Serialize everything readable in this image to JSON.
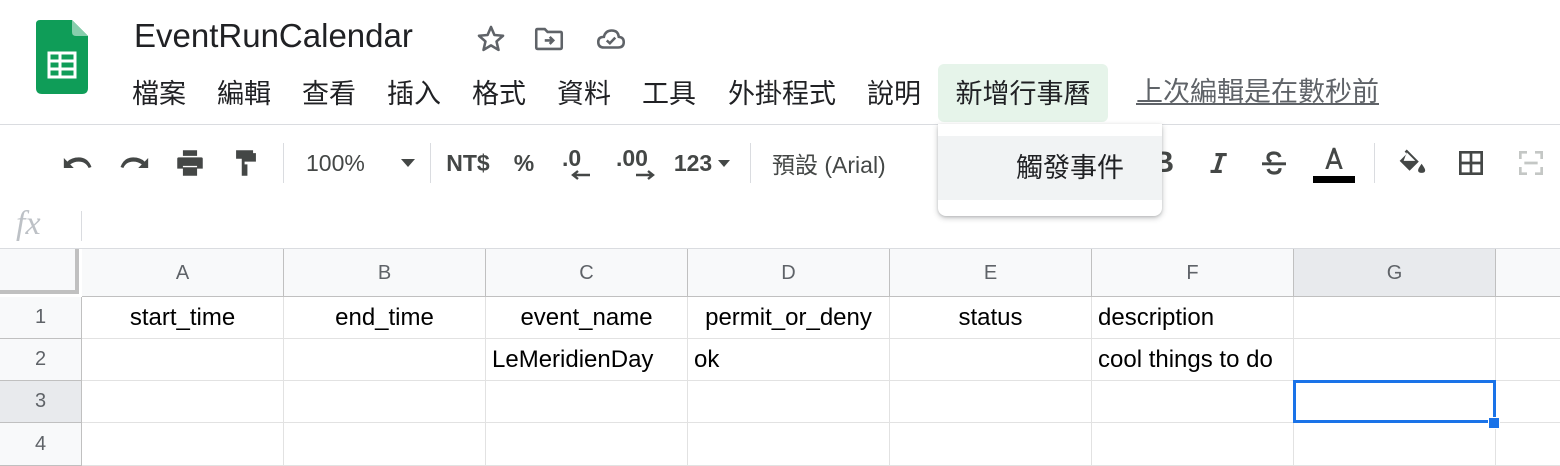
{
  "header": {
    "title": "EventRunCalendar",
    "icons": [
      "star-icon",
      "move-to-folder-icon",
      "cloud-saved-icon"
    ],
    "menu": [
      {
        "label": "檔案"
      },
      {
        "label": "編輯"
      },
      {
        "label": "查看"
      },
      {
        "label": "插入"
      },
      {
        "label": "格式"
      },
      {
        "label": "資料"
      },
      {
        "label": "工具"
      },
      {
        "label": "外掛程式"
      },
      {
        "label": "說明"
      },
      {
        "label": "新增行事曆",
        "active": true
      }
    ],
    "last_edit": "上次編輯是在數秒前"
  },
  "toolbar": {
    "zoom": "100%",
    "currency": "NT$",
    "percent": "%",
    "decrease_decimal": ".0",
    "increase_decimal": ".00",
    "more_formats": "123",
    "font": "預設 (Arial)",
    "text_color": "#000000",
    "icons": [
      "undo-icon",
      "redo-icon",
      "print-icon",
      "paint-format-icon",
      "bold-icon",
      "italic-icon",
      "strikethrough-icon",
      "text-color-icon",
      "fill-color-icon",
      "borders-icon",
      "merge-cells-icon"
    ]
  },
  "formula_bar": {
    "label": "fx",
    "value": ""
  },
  "dropdown": {
    "item": "觸發事件"
  },
  "sheet": {
    "columns": [
      "A",
      "B",
      "C",
      "D",
      "E",
      "F",
      "G"
    ],
    "rows": [
      "1",
      "2",
      "3",
      "4"
    ],
    "cells": [
      [
        "start_time",
        "end_time",
        "event_name",
        "permit_or_deny",
        "status",
        "description",
        ""
      ],
      [
        "",
        "",
        "LeMeridienDay",
        "ok",
        "",
        "cool things to do",
        ""
      ],
      [
        "",
        "",
        "",
        "",
        "",
        "",
        ""
      ],
      [
        "",
        "",
        "",
        "",
        "",
        "",
        ""
      ]
    ],
    "selected_cell": "G3"
  },
  "colors": {
    "accent": "#1a73e8",
    "menu_active_bg": "#e6f4ea",
    "sheets_green": "#0f9d58"
  }
}
